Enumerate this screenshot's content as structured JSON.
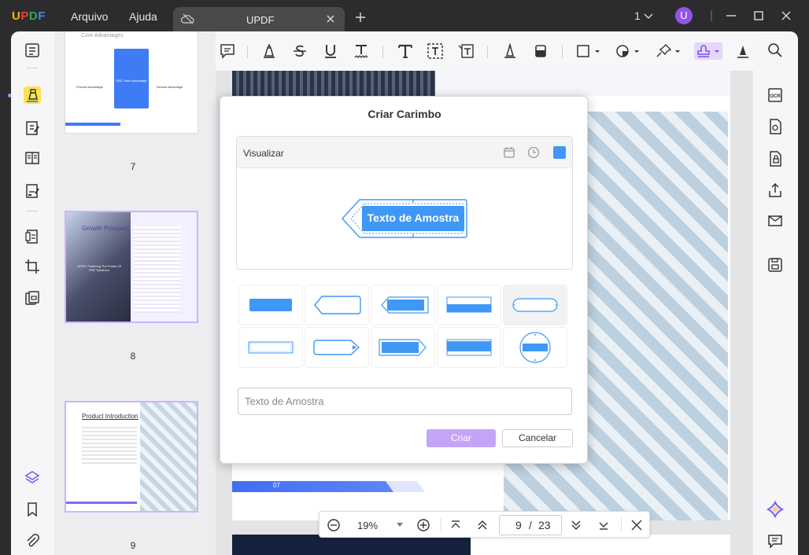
{
  "app": {
    "name": "UPDF",
    "colors": {
      "logo_u": "#f4b400",
      "logo_p": "#ea4335",
      "logo_d": "#34a853",
      "logo_f": "#4285f4",
      "accent": "#9155e6",
      "stamp_blue": "#3f97f6"
    }
  },
  "menu": {
    "file": "Arquivo",
    "help": "Ajuda"
  },
  "tab": {
    "title": "UPDF"
  },
  "titlebar": {
    "page_count": "1",
    "avatar": "U"
  },
  "thumbnails": [
    {
      "number": "7",
      "heading": "Core Advantages",
      "labels": [
        "Product Advantage",
        "R&D Team Advantage",
        "Service Advantage"
      ]
    },
    {
      "number": "8",
      "heading": "Growth Prospect",
      "subtitle": "UPDF: Powering The Future Of PDF Solutions"
    },
    {
      "number": "9",
      "heading": "Product Introduction"
    }
  ],
  "dialog": {
    "title": "Criar Carimbo",
    "preview_label": "Visualizar",
    "stamp_text": "Texto de Amostra",
    "selected_color": "#3f97f6",
    "text_placeholder": "Texto de Amostra",
    "create_button": "Criar",
    "cancel_button": "Cancelar",
    "styles": [
      "solid-rect",
      "left-arrow-outline",
      "left-arrow-filled",
      "top-bar",
      "rounded-outline",
      "thin-outline",
      "right-arrow-outline",
      "right-arrow-filled",
      "filled-rect",
      "circle"
    ],
    "selected_style_index": 4
  },
  "page": {
    "label": "07"
  },
  "zoom": {
    "level": "19%",
    "current_page": "9",
    "separator": "/",
    "total_pages": "23"
  }
}
